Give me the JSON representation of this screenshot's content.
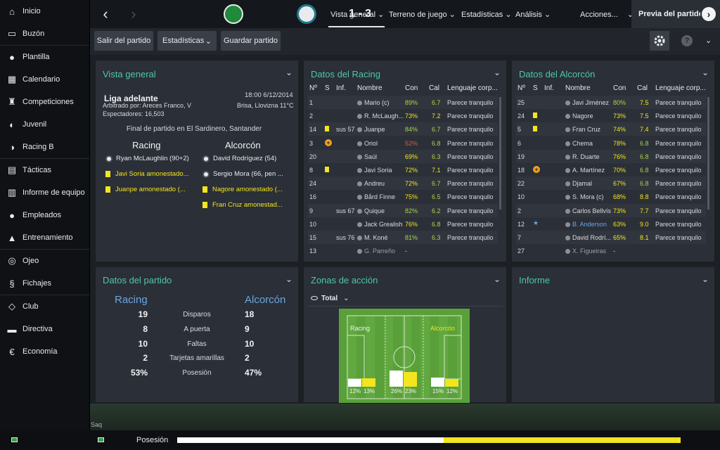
{
  "sidebar": {
    "items": [
      {
        "label": "Inicio",
        "icon": "home-icon"
      },
      {
        "label": "Buzón",
        "icon": "inbox-icon"
      },
      {
        "label": "Plantilla",
        "icon": "squad-icon"
      },
      {
        "label": "Calendario",
        "icon": "calendar-icon"
      },
      {
        "label": "Competiciones",
        "icon": "trophy-icon"
      },
      {
        "label": "Juvenil",
        "icon": "youth-icon"
      },
      {
        "label": "Racing B",
        "icon": "reserve-team-icon"
      },
      {
        "label": "Tácticas",
        "icon": "tactics-icon"
      },
      {
        "label": "Informe de equipo",
        "icon": "report-icon"
      },
      {
        "label": "Empleados",
        "icon": "staff-icon"
      },
      {
        "label": "Entrenamiento",
        "icon": "training-icon"
      },
      {
        "label": "Ojeo",
        "icon": "scouting-icon"
      },
      {
        "label": "Fichajes",
        "icon": "transfers-icon"
      },
      {
        "label": "Club",
        "icon": "club-icon"
      },
      {
        "label": "Directiva",
        "icon": "board-icon"
      },
      {
        "label": "Economía",
        "icon": "finance-icon"
      }
    ]
  },
  "topbar": {
    "score": "1 - 3",
    "menu": [
      "Vista general",
      "Terreno de juego",
      "Estadísticas",
      "Análisis"
    ],
    "actions": "Acciones...",
    "preview": "Previa del partido"
  },
  "toolbar": {
    "leave": "Salir del partido",
    "stats": "Estadísticas",
    "save": "Guardar partido"
  },
  "overview": {
    "title": "Vista general",
    "league": "Liga adelante",
    "datetime": "18:00 6/12/2014",
    "referee": "Arbitrado por: Areces Franco, V",
    "weather": "Brisa, Llovizna 11°C",
    "spectators": "Espectadores: 16,503",
    "result": "Final de partido en El Sardinero, Santander",
    "home_team": "Racing",
    "away_team": "Alcorcón",
    "home_events": [
      {
        "text": "Ryan McLaughlin (90+2)",
        "type": "goal"
      },
      {
        "text": "Javi Soria amonestado...",
        "type": "yellow"
      },
      {
        "text": "Juanpe amonestado (...",
        "type": "yellow"
      }
    ],
    "away_events": [
      {
        "text": "David Rodríguez (54)",
        "type": "goal"
      },
      {
        "text": "Sergio Mora (66, pen ...",
        "type": "goal"
      },
      {
        "text": "Nagore amonestado (...",
        "type": "yellow"
      },
      {
        "text": "Fran Cruz amonestad...",
        "type": "yellow"
      }
    ]
  },
  "racing": {
    "title": "Datos del Racing",
    "headers": [
      "Nº",
      "S",
      "Inf.",
      "Nombre",
      "Con",
      "Cal",
      "Lenguaje corp..."
    ],
    "rows": [
      {
        "n": "1",
        "s": "",
        "inf": "",
        "name": "Mario (c)",
        "con": "89%",
        "cal": "6.7",
        "body": "Parece tranquilo"
      },
      {
        "n": "2",
        "s": "",
        "inf": "",
        "name": "R. McLaugh...",
        "con": "73%",
        "cal": "7.2",
        "body": "Parece tranquilo"
      },
      {
        "n": "14",
        "s": "yellow",
        "inf": "sus 57",
        "name": "Juanpe",
        "con": "84%",
        "cal": "6.7",
        "body": "Parece tranquilo"
      },
      {
        "n": "3",
        "s": "injury",
        "inf": "",
        "name": "Oriol",
        "con": "52%",
        "cal": "6.8",
        "body": "Parece tranquilo"
      },
      {
        "n": "20",
        "s": "",
        "inf": "",
        "name": "Saúl",
        "con": "69%",
        "cal": "6.3",
        "body": "Parece tranquilo"
      },
      {
        "n": "8",
        "s": "yellow",
        "inf": "",
        "name": "Javi Soria",
        "con": "72%",
        "cal": "7.1",
        "body": "Parece tranquilo"
      },
      {
        "n": "24",
        "s": "",
        "inf": "",
        "name": "Andreu",
        "con": "72%",
        "cal": "6.7",
        "body": "Parece tranquilo"
      },
      {
        "n": "16",
        "s": "",
        "inf": "",
        "name": "Bård Finne",
        "con": "75%",
        "cal": "6.5",
        "body": "Parece tranquilo"
      },
      {
        "n": "9",
        "s": "",
        "inf": "sus 67",
        "name": "Quique",
        "con": "82%",
        "cal": "6.2",
        "body": "Parece tranquilo"
      },
      {
        "n": "10",
        "s": "",
        "inf": "",
        "name": "Jack Grealish",
        "con": "76%",
        "cal": "6.8",
        "body": "Parece tranquilo"
      },
      {
        "n": "15",
        "s": "",
        "inf": "sus 76",
        "name": "M. Koné",
        "con": "81%",
        "cal": "6.3",
        "body": "Parece tranquilo"
      },
      {
        "n": "13",
        "s": "",
        "inf": "",
        "name": "G. Parreño",
        "con": "-",
        "cal": "",
        "body": ""
      }
    ]
  },
  "alcorcon": {
    "title": "Datos del Alcorcón",
    "headers": [
      "Nº",
      "S",
      "Inf.",
      "Nombre",
      "Con",
      "Cal",
      "Lenguaje corp..."
    ],
    "rows": [
      {
        "n": "25",
        "s": "",
        "inf": "",
        "name": "Javi Jiménez",
        "con": "80%",
        "cal": "7.5",
        "body": "Parece tranquilo"
      },
      {
        "n": "24",
        "s": "yellow",
        "inf": "",
        "name": "Nagore",
        "con": "73%",
        "cal": "7.5",
        "body": "Parece tranquilo"
      },
      {
        "n": "5",
        "s": "yellow",
        "inf": "",
        "name": "Fran Cruz",
        "con": "74%",
        "cal": "7.4",
        "body": "Parece tranquilo"
      },
      {
        "n": "6",
        "s": "",
        "inf": "",
        "name": "Chema",
        "con": "78%",
        "cal": "6.8",
        "body": "Parece tranquilo"
      },
      {
        "n": "19",
        "s": "",
        "inf": "",
        "name": "R. Duarte",
        "con": "76%",
        "cal": "6.8",
        "body": "Parece tranquilo"
      },
      {
        "n": "18",
        "s": "injury",
        "inf": "",
        "name": "A. Martínez",
        "con": "70%",
        "cal": "6.8",
        "body": "Parece tranquilo"
      },
      {
        "n": "22",
        "s": "",
        "inf": "",
        "name": "Djamal",
        "con": "67%",
        "cal": "6.8",
        "body": "Parece tranquilo"
      },
      {
        "n": "10",
        "s": "",
        "inf": "",
        "name": "S. Mora (c)",
        "con": "68%",
        "cal": "8.8",
        "body": "Parece tranquilo"
      },
      {
        "n": "2",
        "s": "",
        "inf": "",
        "name": "Carlos Bellvís",
        "con": "73%",
        "cal": "7.7",
        "body": "Parece tranquilo"
      },
      {
        "n": "12",
        "s": "star",
        "inf": "",
        "name": "B. Anderson",
        "con": "63%",
        "cal": "9.0",
        "body": "Parece tranquilo"
      },
      {
        "n": "7",
        "s": "",
        "inf": "",
        "name": "David Rodrí...",
        "con": "65%",
        "cal": "8.1",
        "body": "Parece tranquilo"
      },
      {
        "n": "27",
        "s": "",
        "inf": "",
        "name": "X. Figueiras",
        "con": "-",
        "cal": "",
        "body": ""
      }
    ]
  },
  "match_stats": {
    "title": "Datos del partido",
    "home": "Racing",
    "away": "Alcorcón",
    "rows": [
      {
        "label": "Disparos",
        "home": "19",
        "away": "18"
      },
      {
        "label": "A puerta",
        "home": "8",
        "away": "9"
      },
      {
        "label": "Faltas",
        "home": "10",
        "away": "10"
      },
      {
        "label": "Tarjetas amarillas",
        "home": "2",
        "away": "2"
      },
      {
        "label": "Posesión",
        "home": "53%",
        "away": "47%"
      }
    ]
  },
  "zones": {
    "title": "Zonas de acción",
    "filter": "Total",
    "home": "Racing",
    "away": "Alcorcón",
    "bars": [
      {
        "home": 0.12,
        "away": 0.13,
        "home_label": "12%",
        "away_label": "13%"
      },
      {
        "home": 0.26,
        "away": 0.23,
        "home_label": "26%",
        "away_label": "23%"
      },
      {
        "home": 0.15,
        "away": 0.12,
        "home_label": "15%",
        "away_label": "12%"
      }
    ]
  },
  "report": {
    "title": "Informe"
  },
  "bottom": {
    "search": "Saq",
    "possession_label": "Posesión",
    "possession_home": 0.53,
    "home_color": "#ffffff",
    "away_color": "#f3e51e"
  },
  "colors": {
    "accent": "#4fc7a7",
    "team_blue": "#6aa6e0",
    "yellow": "#f3e51e",
    "good": "#a9d44a"
  }
}
